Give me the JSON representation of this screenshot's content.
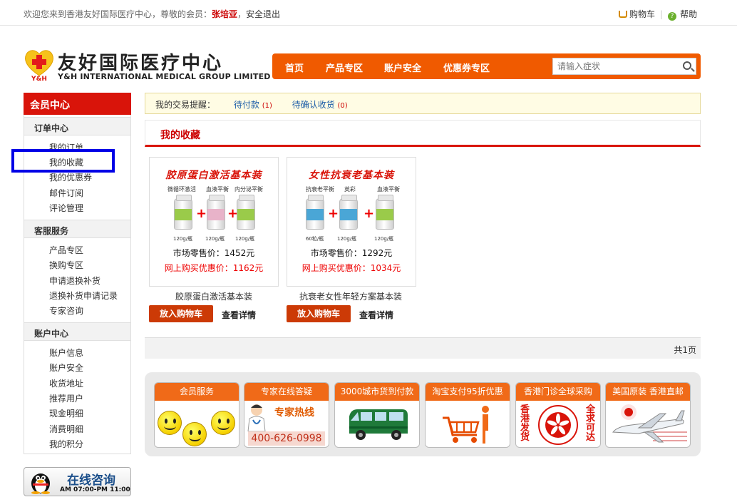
{
  "topbar": {
    "welcome": "欢迎您来到香港友好国际医疗中心，尊敬的会员：",
    "username": "张培亚",
    "separator": "，",
    "logout": "安全退出",
    "cart": "购物车",
    "help": "帮助"
  },
  "logo": {
    "cn": "友好国际医疗中心",
    "en": "Y&H INTERNATIONAL MEDICAL GROUP LIMITED",
    "badge": "Y&H"
  },
  "nav": {
    "items": [
      "首页",
      "产品专区",
      "账户安全",
      "优惠券专区"
    ],
    "search_placeholder": "请输入症状"
  },
  "sidebar": {
    "title": "会员中心",
    "sections": [
      {
        "title": "订单中心",
        "items": [
          "我的订单",
          "我的收藏",
          "我的优惠券",
          "邮件订阅",
          "评论管理"
        ]
      },
      {
        "title": "客服服务",
        "items": [
          "产品专区",
          "换购专区",
          "申请退换补货",
          "退换补货申请记录",
          "专家咨询"
        ]
      },
      {
        "title": "账户中心",
        "items": [
          "账户信息",
          "账户安全",
          "收货地址",
          "推荐用户",
          "现金明细",
          "消费明细",
          "我的积分"
        ]
      }
    ]
  },
  "chat": {
    "title": "在线咨询",
    "hours": "AM 07:00-PM 11:00"
  },
  "notice": {
    "label": "我的交易提醒：",
    "pending_pay": "待付款",
    "pending_pay_count": "(1)",
    "pending_receive": "待确认收货",
    "pending_receive_count": "(0)"
  },
  "favorites": {
    "title": "我的收藏",
    "cart_button": "放入购物车",
    "detail_button": "查看详情",
    "products": [
      {
        "banner": "胶原蛋白激活基本装",
        "labels": [
          "微循环激活",
          "血液平衡",
          "内分泌平衡"
        ],
        "weights": [
          "120g/瓶",
          "120g/瓶",
          "120g/瓶"
        ],
        "market_price": "市场零售价：1452元",
        "online_price": "网上购买优惠价：1162元",
        "name": "胶原蛋白激活基本装",
        "label_colors": [
          "#9acb4a",
          "#e8b3c9",
          "#9acb4a"
        ]
      },
      {
        "banner": "女性抗衰老基本装",
        "labels": [
          "抗衰老平衡",
          "英彩",
          "血液平衡"
        ],
        "weights": [
          "60粒/瓶",
          "120g/瓶",
          "120g/瓶"
        ],
        "market_price": "市场零售价：1292元",
        "online_price": "网上购买优惠价：1034元",
        "name": "抗衰老女性年轻方案基本装",
        "label_colors": [
          "#4aa6d6",
          "#4aa6d6",
          "#9acb4a"
        ]
      }
    ]
  },
  "pager": {
    "text": "共1页"
  },
  "promo": {
    "tiles": [
      {
        "title": "会员服务"
      },
      {
        "title": "专家在线答疑",
        "line1": "专家热线",
        "phone": "400-626-0998"
      },
      {
        "title": "3000城市货到付款"
      },
      {
        "title": "淘宝支付95折优惠"
      },
      {
        "title": "香港门诊全球采购",
        "left_text": "香港发货",
        "right_text": "全求可达"
      },
      {
        "title": "美国原装 香港直邮"
      }
    ]
  },
  "colors": {
    "brand_red": "#d9140a",
    "nav_orange": "#f05a00",
    "link_blue": "#1d5ea8",
    "highlight_box": "#0000e6"
  }
}
